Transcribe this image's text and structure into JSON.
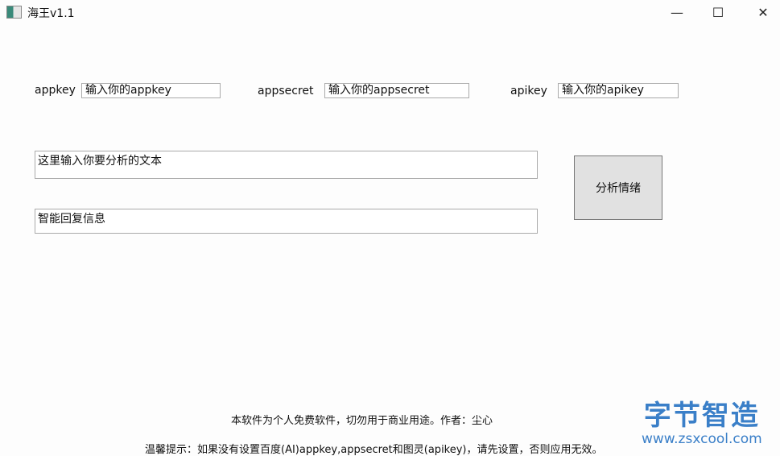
{
  "window": {
    "title": "海王v1.1",
    "minimize": "—",
    "maximize": "☐",
    "close": "✕"
  },
  "fields": {
    "appkey": {
      "label": "appkey",
      "value": "输入你的appkey"
    },
    "appsecret": {
      "label": "appsecret",
      "value": "输入你的appsecret"
    },
    "apikey": {
      "label": "apikey",
      "value": "输入你的apikey"
    }
  },
  "input_text": "这里输入你要分析的文本",
  "reply_text": "智能回复信息",
  "analyze_button": "分析情绪",
  "footer": {
    "disclaimer": "本软件为个人免费软件，切勿用于商业用途。作者：尘心",
    "tip": "温馨提示：如果没有设置百度(AI)appkey,appsecret和图灵(apikey)，请先设置，否则应用无效。"
  },
  "watermark": {
    "name": "字节智造",
    "url": "www.zsxcool.com"
  }
}
